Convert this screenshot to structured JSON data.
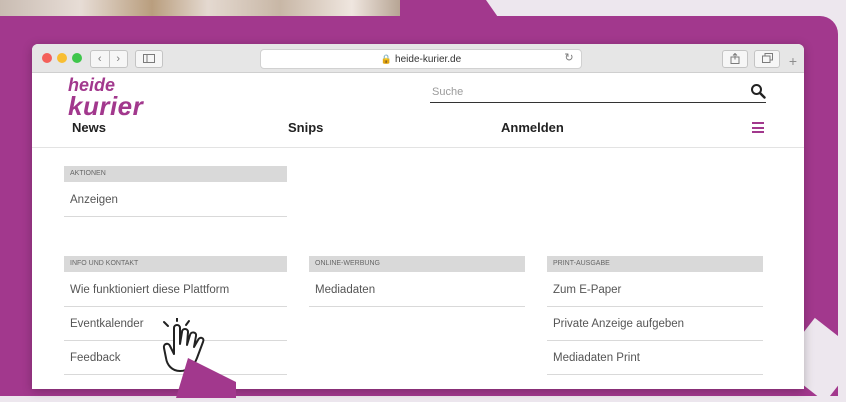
{
  "browser": {
    "url": "heide-kurier.de",
    "nav_back": "‹",
    "nav_forward": "›",
    "lock_glyph": "🔒",
    "reload_glyph": "↻",
    "newtab_glyph": "+"
  },
  "site": {
    "logo_top": "heide",
    "logo_bottom": "kurier",
    "search_placeholder": "Suche",
    "accent_color": "#a2388d"
  },
  "nav": {
    "news": "News",
    "snips": "Snips",
    "login": "Anmelden"
  },
  "menu": {
    "aktionen": {
      "heading": "AKTIONEN",
      "items": [
        "Anzeigen"
      ]
    },
    "info": {
      "heading": "INFO UND KONTAKT",
      "items": [
        "Wie funktioniert diese Plattform",
        "Eventkalender",
        "Feedback"
      ]
    },
    "online": {
      "heading": "ONLINE-WERBUNG",
      "items": [
        "Mediadaten"
      ]
    },
    "print": {
      "heading": "PRINT-AUSGABE",
      "items": [
        "Zum E-Paper",
        "Private Anzeige aufgeben",
        "Mediadaten Print"
      ]
    }
  }
}
